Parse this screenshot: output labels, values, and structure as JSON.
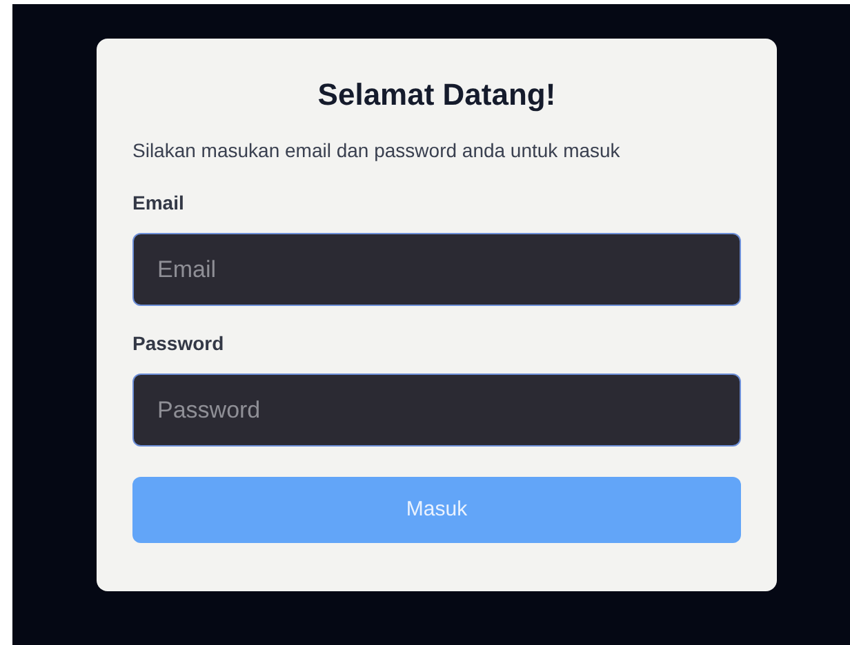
{
  "card": {
    "title": "Selamat Datang!",
    "subtitle": "Silakan masukan email dan password anda untuk masuk"
  },
  "fields": [
    {
      "label": "Email",
      "placeholder": "Email"
    },
    {
      "label": "Password",
      "placeholder": "Password"
    }
  ],
  "submit": {
    "label": "Masuk"
  }
}
